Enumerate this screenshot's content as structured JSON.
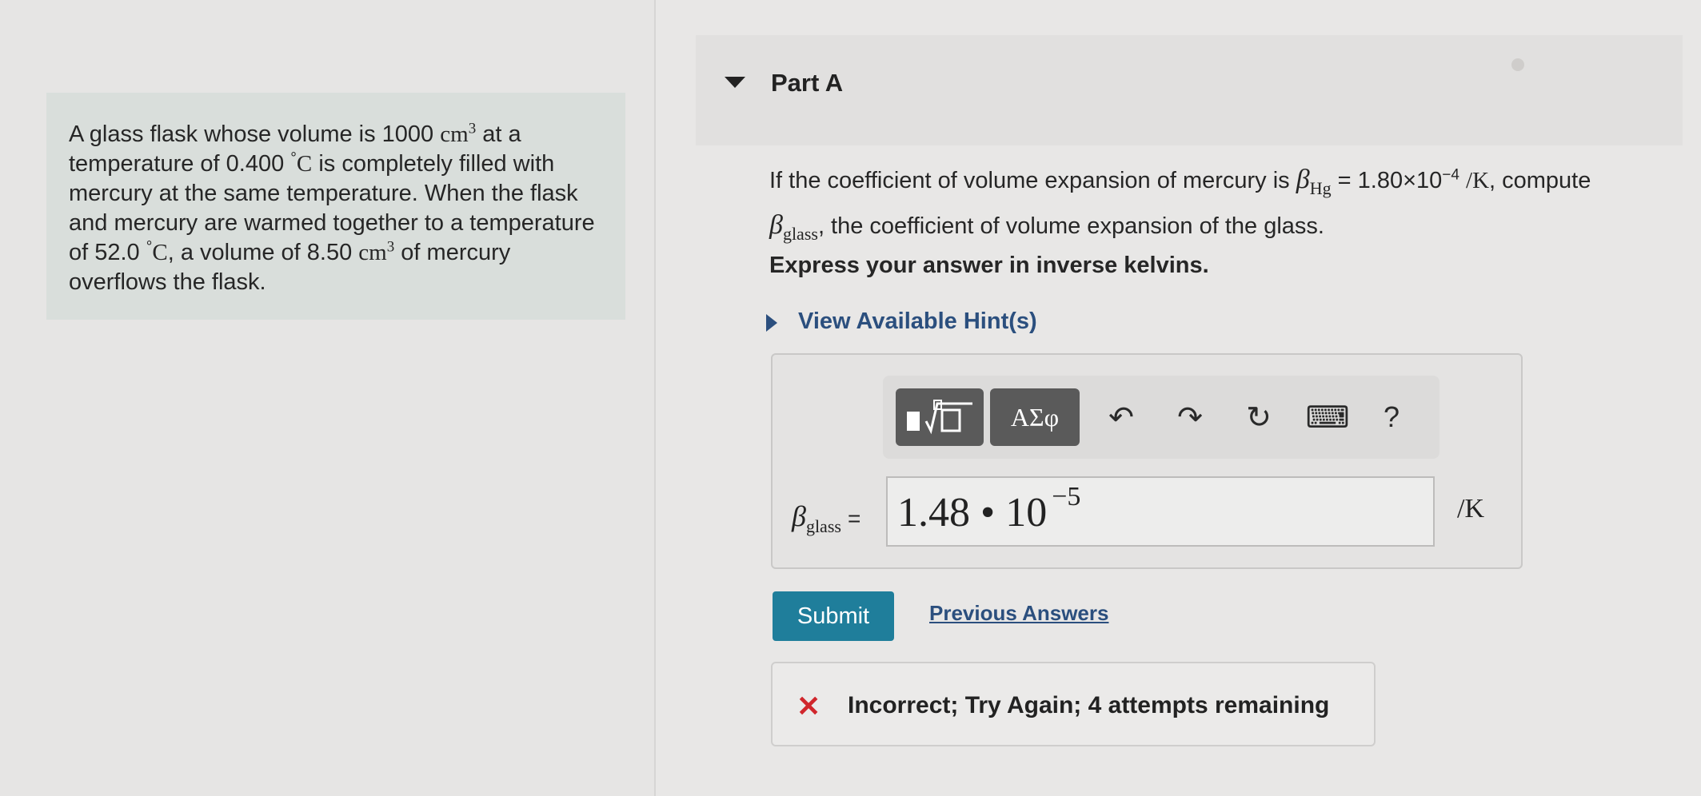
{
  "problem": {
    "p1": "A glass flask whose volume is 1000",
    "unit_cm": "cm",
    "exp3": "3",
    "p2": "at a temperature of 0.400",
    "deg": "°",
    "unit_C": "C",
    "p3": "is completely filled with mercury at the same temperature. When the flask and mercury are warmed together to a temperature of 52.0",
    "p4": ", a volume of 8.50",
    "p5": "of mercury overflows the flask."
  },
  "part": {
    "title": "Part A"
  },
  "question": {
    "intro": "If the coefficient of volume expansion of mercury is",
    "beta": "β",
    "sub_hg": "Hg",
    "eq_value": "= 1.80×10",
    "exp_val": "−4",
    "unit": "/K",
    "mid": ", compute",
    "sub_glass": "glass",
    "tail": ", the coefficient of volume expansion of the glass."
  },
  "instruction": "Express your answer in inverse kelvins.",
  "hints_label": "View Available Hint(s)",
  "toolbar": {
    "templates_icon": "▮√□",
    "greek": "ΑΣφ",
    "undo": "↶",
    "redo": "↷",
    "reset": "↻",
    "keyboard": "⌨",
    "help": "?"
  },
  "answer": {
    "beta": "β",
    "sub": "glass",
    "equals": "=",
    "mantissa": "1.48 • 10",
    "exponent": "−5",
    "unit": "/K"
  },
  "submit_label": "Submit",
  "previous_answers_label": "Previous Answers",
  "feedback": {
    "icon": "✕",
    "text": "Incorrect; Try Again; 4 attempts remaining",
    "color": "#d0262c"
  },
  "colors": {
    "link": "#2b4f7e",
    "submit": "#1f7e9b"
  }
}
